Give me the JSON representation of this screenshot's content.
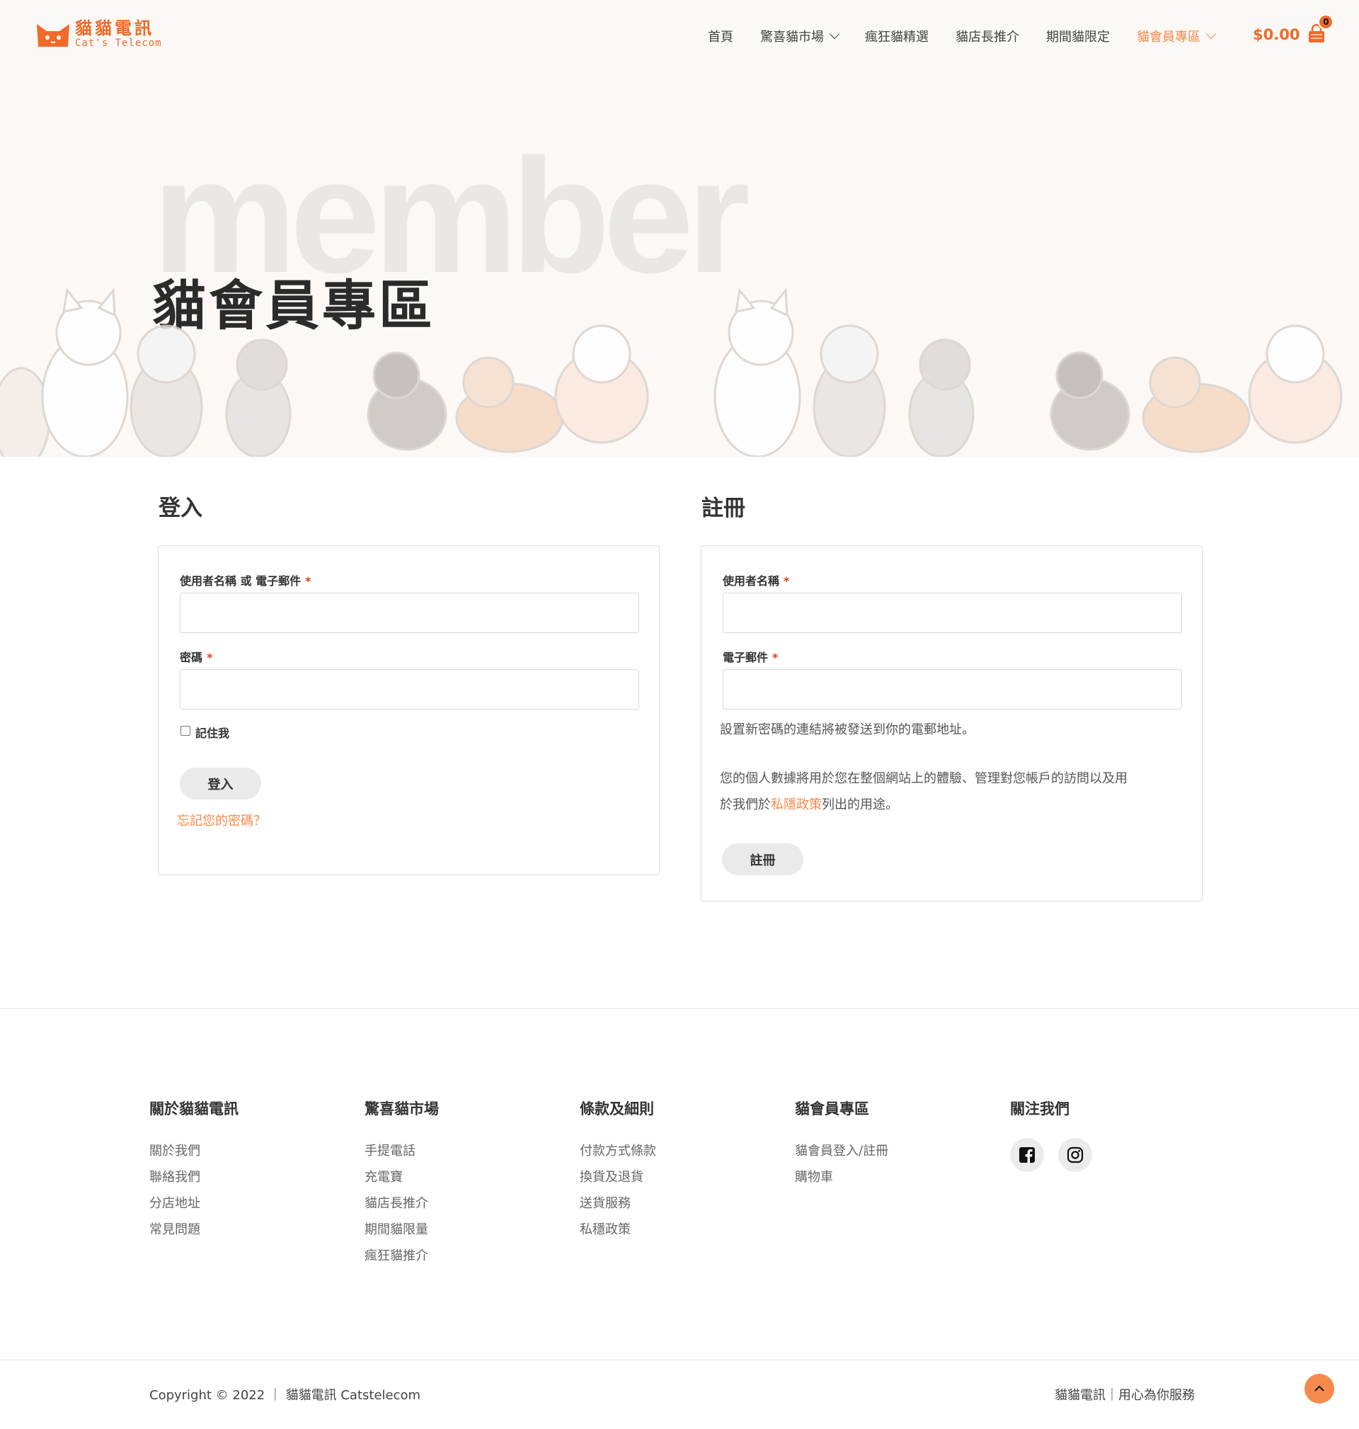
{
  "brand": {
    "name": "貓貓電訊",
    "sub": "Cat's Telecom",
    "accent": "#f06a2a",
    "accent_light": "#f58a4c"
  },
  "nav": {
    "items": [
      {
        "label": "首頁"
      },
      {
        "label": "驚喜貓市場"
      },
      {
        "label": "瘋狂貓精選"
      },
      {
        "label": "貓店長推介"
      },
      {
        "label": "期間貓限定"
      },
      {
        "label": "貓會員專區"
      }
    ]
  },
  "cart": {
    "total": "$0.00",
    "count": "0"
  },
  "hero": {
    "bg_word": "member",
    "title": "貓會員專區"
  },
  "login": {
    "heading": "登入",
    "username_label": "使用者名稱 或 電子郵件",
    "password_label": "密碼",
    "remember_label": "記住我",
    "submit_label": "登入",
    "forgot_link": "忘記您的密碼？"
  },
  "register": {
    "heading": "註冊",
    "username_label": "使用者名稱",
    "email_label": "電子郵件",
    "password_note": "設置新密碼的連結將被發送到你的電郵地址。",
    "privacy_text_1": "您的個人數據將用於您在整個網站上的體驗、管理對您帳戶的訪問以及用",
    "privacy_text_2_pre": "於我們於",
    "privacy_link": "私隱政策",
    "privacy_text_2_post": "列出的用途。",
    "submit_label": "註冊"
  },
  "footer": {
    "columns": [
      {
        "title": "關於貓貓電訊",
        "links": [
          "關於我們",
          "聯絡我們",
          "分店地址",
          "常見問題"
        ]
      },
      {
        "title": "驚喜貓市場",
        "links": [
          "手提電話",
          "充電寶",
          "貓店長推介",
          "期間貓限量",
          "瘋狂貓推介"
        ]
      },
      {
        "title": "條款及細則",
        "links": [
          "付款方式條款",
          "換貨及退貨",
          "送貨服務",
          "私穩政策"
        ]
      },
      {
        "title": "貓會員專區",
        "links": [
          "貓會員登入/註冊",
          "購物車"
        ]
      },
      {
        "title": "關注我們",
        "social": [
          "facebook-icon",
          "instagram-icon"
        ]
      }
    ],
    "copyright": "Copyright © 2022 ｜ 貓貓電訊 Catstelecom",
    "tagline": "貓貓電訊｜用心為你服務"
  }
}
